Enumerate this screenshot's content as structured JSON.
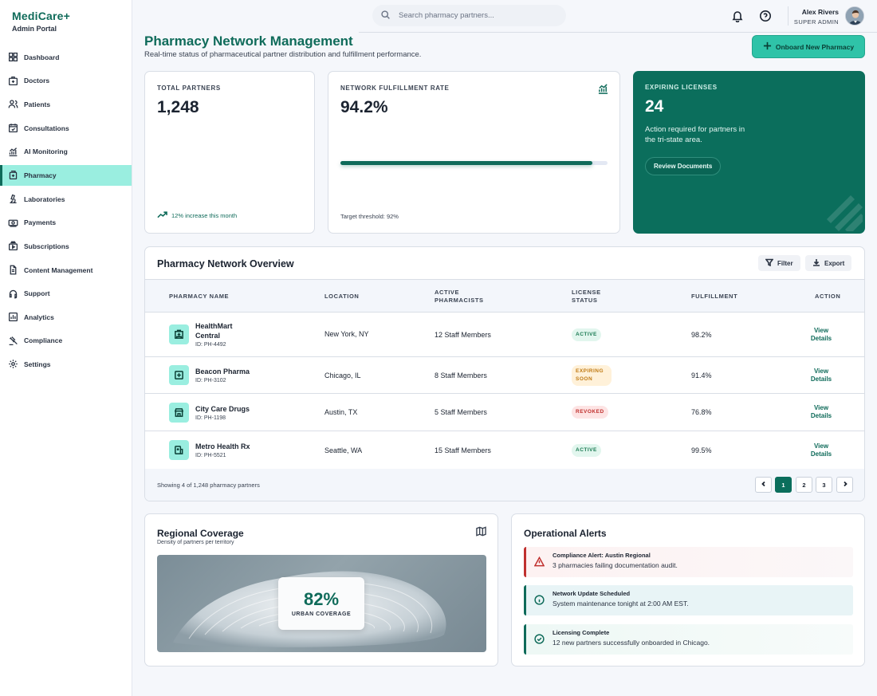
{
  "brand": {
    "title": "MediCare+",
    "subtitle": "Admin Portal"
  },
  "sidebar": {
    "items": [
      {
        "label": "Dashboard",
        "icon": "dashboard-icon"
      },
      {
        "label": "Doctors",
        "icon": "doctor-icon"
      },
      {
        "label": "Patients",
        "icon": "patients-icon"
      },
      {
        "label": "Consultations",
        "icon": "calendar-icon"
      },
      {
        "label": "AI Monitoring",
        "icon": "chart-icon"
      },
      {
        "label": "Pharmacy",
        "icon": "pharmacy-icon",
        "active": true
      },
      {
        "label": "Laboratories",
        "icon": "microscope-icon"
      },
      {
        "label": "Payments",
        "icon": "payments-icon"
      },
      {
        "label": "Subscriptions",
        "icon": "subscriptions-icon"
      },
      {
        "label": "Content Management",
        "icon": "document-icon"
      },
      {
        "label": "Support",
        "icon": "headset-icon"
      },
      {
        "label": "Analytics",
        "icon": "analytics-icon"
      },
      {
        "label": "Compliance",
        "icon": "gavel-icon"
      },
      {
        "label": "Settings",
        "icon": "gear-icon"
      }
    ]
  },
  "header": {
    "search_placeholder": "Search pharmacy partners...",
    "user_name": "Alex Rivers",
    "user_role": "SUPER ADMIN"
  },
  "page": {
    "title": "Pharmacy Network Management",
    "subtitle": "Real-time status of pharmaceutical partner distribution and fulfillment performance.",
    "onboard_label": "Onboard New Pharmacy"
  },
  "stats": {
    "partners": {
      "label": "TOTAL PARTNERS",
      "value": "1,248",
      "trend": "12% increase this month"
    },
    "fulfillment": {
      "label": "NETWORK FULFILLMENT RATE",
      "value": "94.2%",
      "progress": 0.942,
      "threshold": "Target threshold: 92%"
    },
    "licenses": {
      "label": "EXPIRING LICENSES",
      "value": "24",
      "desc": "Action required for partners in the tri-state area.",
      "button": "Review Documents"
    }
  },
  "table": {
    "title": "Pharmacy Network Overview",
    "filter_label": "Filter",
    "export_label": "Export",
    "headers": {
      "name": "PHARMACY NAME",
      "location": "LOCATION",
      "pharmacists": "ACTIVE PHARMACISTS",
      "license": "LICENSE STATUS",
      "fulfillment": "FULFILLMENT",
      "action": "ACTION"
    },
    "rows": [
      {
        "name": "HealthMart Central",
        "id": "ID: PH-4492",
        "location": "New York, NY",
        "pharmacists": "12 Staff Members",
        "status": "ACTIVE",
        "fulfillment": "98.2%",
        "action": "View Details"
      },
      {
        "name": "Beacon Pharma",
        "id": "ID: PH-3102",
        "location": "Chicago, IL",
        "pharmacists": "8 Staff Members",
        "status": "EXPIRING SOON",
        "fulfillment": "91.4%",
        "action": "View Details"
      },
      {
        "name": "City Care Drugs",
        "id": "ID: PH-1198",
        "location": "Austin, TX",
        "pharmacists": "5 Staff Members",
        "status": "REVOKED",
        "fulfillment": "76.8%",
        "action": "View Details"
      },
      {
        "name": "Metro Health Rx",
        "id": "ID: PH-5521",
        "location": "Seattle, WA",
        "pharmacists": "15 Staff Members",
        "status": "ACTIVE",
        "fulfillment": "99.5%",
        "action": "View Details"
      }
    ],
    "showing": "Showing 4 of 1,248 pharmacy partners",
    "pages": [
      "1",
      "2",
      "3"
    ]
  },
  "region": {
    "title": "Regional Coverage",
    "subtitle": "Density of partners per territory",
    "value": "82%",
    "label": "URBAN COVERAGE"
  },
  "alerts": {
    "title": "Operational Alerts",
    "items": [
      {
        "title": "Compliance Alert: Austin Regional",
        "message": "3 pharmacies failing documentation audit."
      },
      {
        "title": "Network Update Scheduled",
        "message": "System maintenance tonight at 2:00 AM EST."
      },
      {
        "title": "Licensing Complete",
        "message": "12 new partners successfully onboarded in Chicago."
      }
    ]
  },
  "colors": {
    "brand": "#0f6b5a",
    "accent": "#2fc3a8",
    "active_nav": "#9aeee0",
    "danger": "#c0302e",
    "warning": "#c07a13"
  }
}
